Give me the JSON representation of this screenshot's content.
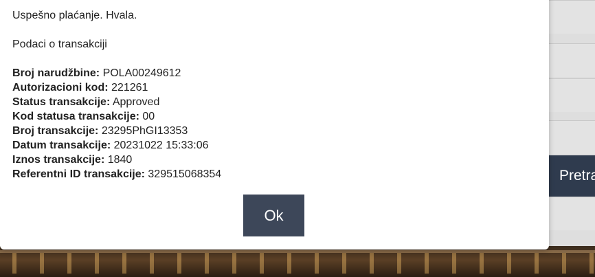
{
  "modal": {
    "success_message": "Uspešno plaćanje. Hvala.",
    "details_heading": "Podaci o transakciji",
    "details": [
      {
        "label": "Broj narudžbine:",
        "value": "POLA00249612"
      },
      {
        "label": "Autorizacioni kod:",
        "value": "221261"
      },
      {
        "label": "Status transakcije:",
        "value": "Approved"
      },
      {
        "label": "Kod statusa transakcije:",
        "value": "00"
      },
      {
        "label": "Broj transakcije:",
        "value": "23295PhGI13353"
      },
      {
        "label": "Datum transakcije:",
        "value": "20231022 15:33:06"
      },
      {
        "label": "Iznos transakcije:",
        "value": "1840"
      },
      {
        "label": "Referentni ID transakcije:",
        "value": "329515068354"
      }
    ],
    "ok_label": "Ok"
  },
  "background": {
    "search_button_label": "Pretraži"
  },
  "colors": {
    "button": "#3d4759",
    "background_button": "#2f3b4e",
    "modal": "#ffffff"
  }
}
